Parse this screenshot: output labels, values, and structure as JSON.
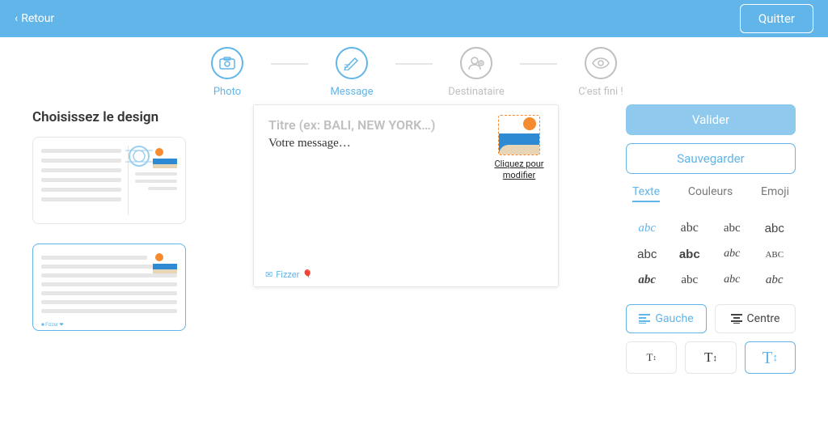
{
  "header": {
    "back": "Retour",
    "quit": "Quitter"
  },
  "stepper": {
    "s1": "Photo",
    "s2": "Message",
    "s3": "Destinataire",
    "s4": "C'est fini !"
  },
  "left": {
    "title": "Choisissez le design"
  },
  "editor": {
    "title_placeholder": "Titre (ex: BALI, NEW YORK…)",
    "msg_placeholder": "Votre message…",
    "stamp_label": "Cliquez pour modifier",
    "brand": "Fizzer"
  },
  "panel": {
    "validate": "Valider",
    "save": "Sauvegarder",
    "tabs": {
      "text": "Texte",
      "colors": "Couleurs",
      "emoji": "Emoji"
    },
    "align": {
      "left": "Gauche",
      "center": "Centre"
    },
    "sizes": {
      "small": "T꜡",
      "medium": "T꜡",
      "large": "T꜡"
    },
    "font_sample": "abc"
  },
  "fonts": [
    {
      "css": "italic 15px 'Brush Script MT',cursive",
      "active": true
    },
    {
      "css": "16px 'Brush Script MT',cursive"
    },
    {
      "css": "15px 'Comic Sans MS',cursive"
    },
    {
      "css": "15px Helvetica"
    },
    {
      "css": "15px Arial"
    },
    {
      "css": "bold 15px Helvetica"
    },
    {
      "css": "italic 14px Georgia"
    },
    {
      "css": "15px 'Times New Roman',serif;font-variant:small-caps"
    },
    {
      "css": "bold italic 15px 'Times New Roman',serif"
    },
    {
      "css": "15px 'Lucida Handwriting',cursive"
    },
    {
      "css": "italic 14px 'Brush Script MT',cursive"
    },
    {
      "css": "italic 15px Georgia,serif"
    }
  ]
}
